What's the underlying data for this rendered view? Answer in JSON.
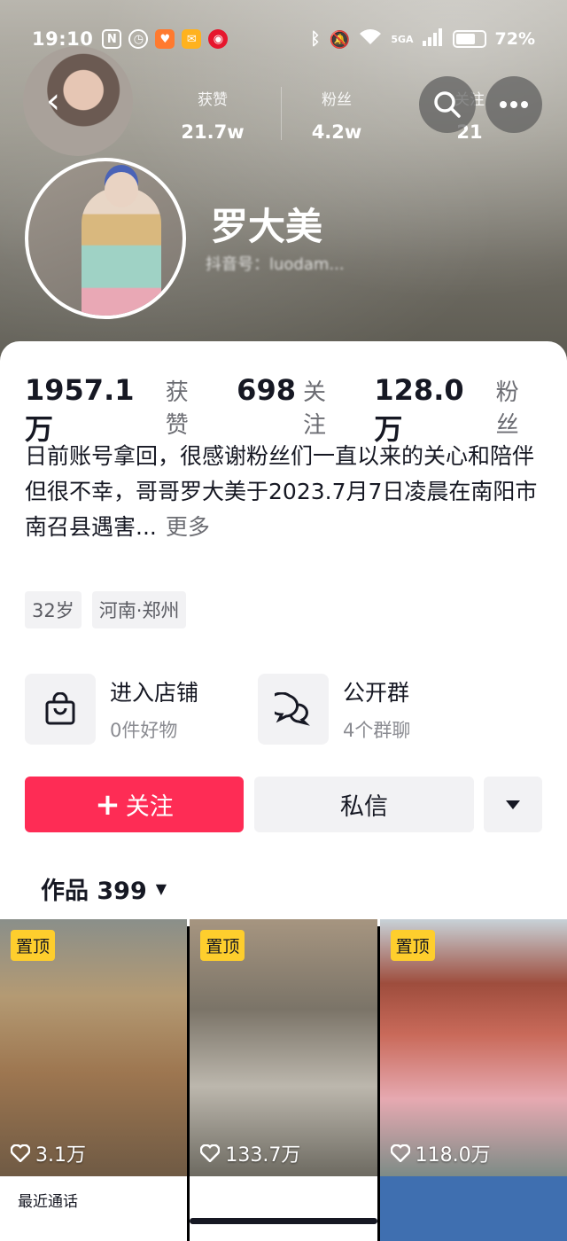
{
  "status_bar": {
    "time": "19:10",
    "network": "5GA",
    "battery": "72%",
    "battery_level": 0.72
  },
  "header": {
    "mini_stats": [
      {
        "label": "获赞",
        "value": "21.7w"
      },
      {
        "label": "粉丝",
        "value": "4.2w"
      },
      {
        "label": "关注",
        "value": "21"
      }
    ],
    "name": "罗大美",
    "id_text": "抖音号：luodam..."
  },
  "stats": [
    {
      "value": "1957.1万",
      "label": "获赞"
    },
    {
      "value": "698",
      "label": "关注"
    },
    {
      "value": "128.0万",
      "label": "粉丝"
    }
  ],
  "bio": {
    "line1": "日前账号拿回，很感谢粉丝们一直以来的关心和陪伴",
    "line2": "但很不幸，哥哥罗大美于2023.7月7日凌晨在南阳市南召县遇害...",
    "more": "更多"
  },
  "tags": [
    "32岁",
    "河南·郑州"
  ],
  "entries": {
    "shop": {
      "title": "进入店铺",
      "subtitle": "0件好物"
    },
    "group": {
      "title": "公开群",
      "subtitle": "4个群聊"
    }
  },
  "actions": {
    "follow_plus": "+",
    "follow": "关注",
    "message": "私信"
  },
  "works": {
    "label": "作品 399"
  },
  "grid": [
    {
      "pin": "置顶",
      "likes": "3.1万"
    },
    {
      "pin": "置顶",
      "likes": "133.7万"
    },
    {
      "pin": "置顶",
      "likes": "118.0万"
    }
  ],
  "row2": {
    "recent": "最近通话"
  },
  "colors": {
    "follow": "#fe2c55",
    "pin": "#fece2d",
    "text": "#161823"
  }
}
